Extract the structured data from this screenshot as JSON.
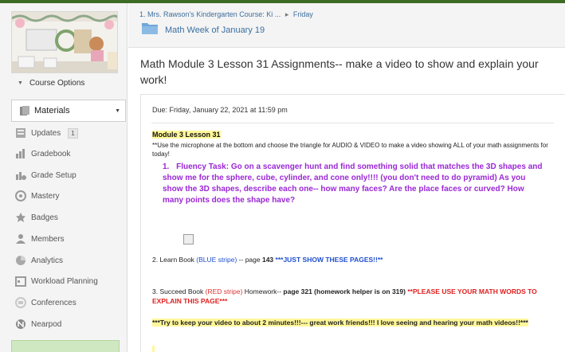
{
  "sidebar": {
    "course_options": "Course Options",
    "materials": "Materials",
    "items": [
      {
        "label": "Updates",
        "icon": "updates-icon",
        "count": "1"
      },
      {
        "label": "Gradebook",
        "icon": "gradebook-icon"
      },
      {
        "label": "Grade Setup",
        "icon": "grade-setup-icon"
      },
      {
        "label": "Mastery",
        "icon": "mastery-icon"
      },
      {
        "label": "Badges",
        "icon": "badge-star-icon"
      },
      {
        "label": "Members",
        "icon": "members-icon"
      },
      {
        "label": "Analytics",
        "icon": "analytics-icon"
      },
      {
        "label": "Workload Planning",
        "icon": "workload-planning-icon"
      },
      {
        "label": "Conferences",
        "icon": "conferences-icon"
      },
      {
        "label": "Nearpod",
        "icon": "nearpod-icon"
      }
    ]
  },
  "header": {
    "breadcrumb_1": "1. Mrs. Rawson's Kindergarten Course: Ki ...",
    "breadcrumb_sep": "▸",
    "breadcrumb_2": "Friday",
    "folder_title": "Math Week of January 19"
  },
  "main": {
    "title": "Math Module 3 Lesson 31 Assignments-- make a video to show and explain your work!",
    "due": "Due: Friday, January 22, 2021 at 11:59 pm",
    "lesson_head": "Module 3  Lesson 31",
    "intro": "**Use the microphone at the bottom and choose the triangle for AUDIO & VIDEO to make a video showing ALL of your math assignments for today!",
    "fluency_num": "1.",
    "fluency": "Fluency Task: Go on a scavenger hunt and find something solid that matches the 3D shapes and show me for the sphere, cube, cylinder, and cone only!!!! (you don't need to do pyramid) As you show the 3D shapes, describe each one-- how many faces? Are the place faces or curved? How many points does the shape have?",
    "item2": {
      "prefix": "2.  Learn Book ",
      "stripe": "(BLUE stripe)",
      "middle": " -- page ",
      "page": "143",
      "note": " ***JUST SHOW THESE PAGES!!**"
    },
    "item3": {
      "prefix": "3.  Succeed Book ",
      "stripe": "(RED stripe)",
      "middle": " Homework-- ",
      "page": "page 321",
      "helper": "  (homework helper is on 319) ",
      "note": "**PLEASE USE YOUR MATH WORDS TO EXPLAIN THIS PAGE***"
    },
    "closing": "***Try to keep your video to about 2 minutes!!!--- great work friends!!!  I love seeing and hearing your math videos!!***"
  },
  "colors": {
    "topbar": "#3d6b24",
    "link": "#3c6e9c",
    "fluency": "#9b27d6",
    "blue_text": "#1f4fcf",
    "red_text": "#e03030",
    "highlight": "#fff799"
  }
}
